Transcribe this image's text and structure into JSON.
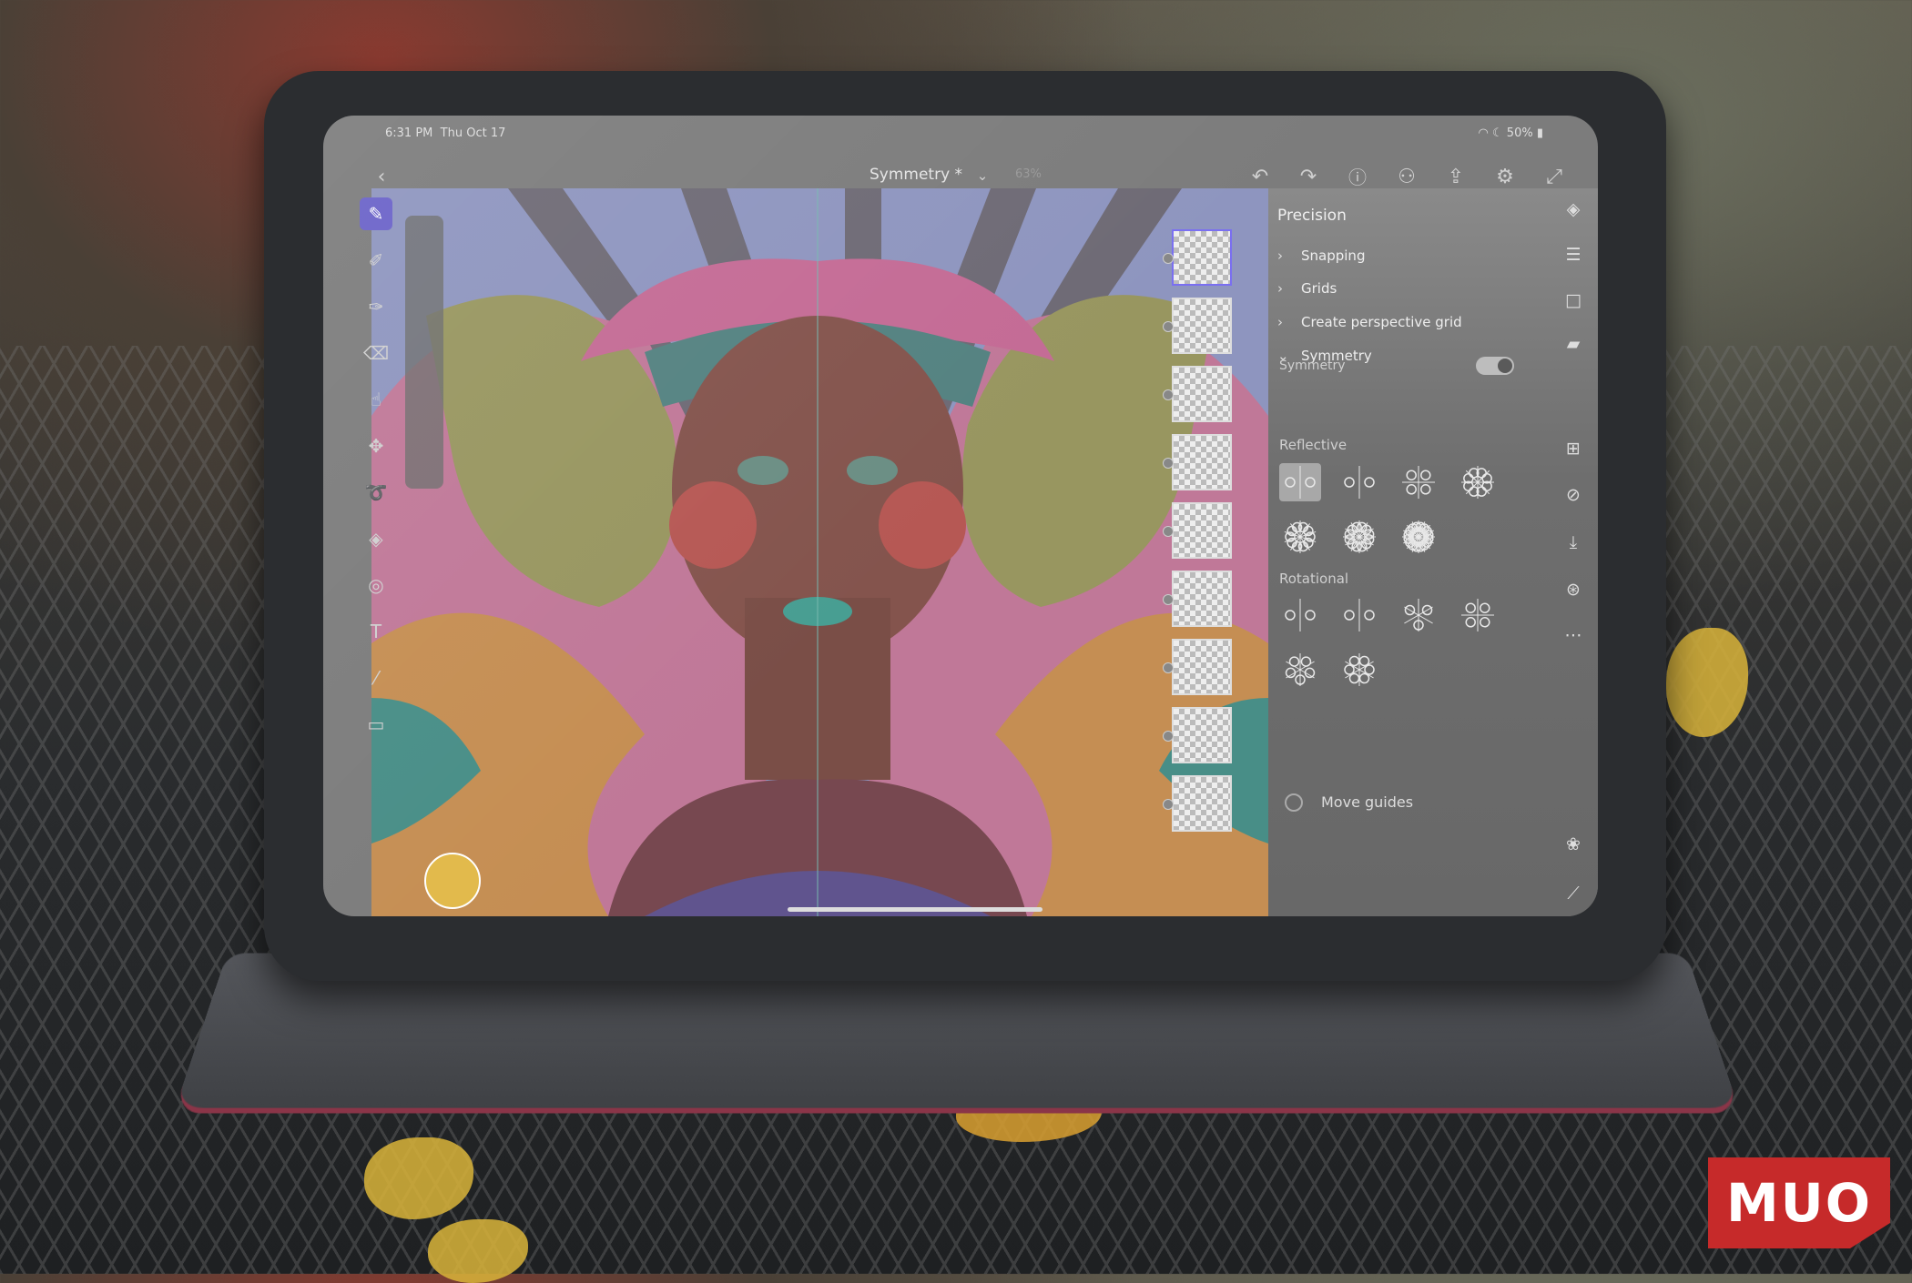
{
  "status_bar": {
    "time": "6:31 PM",
    "date": "Thu Oct 17",
    "battery": "50%"
  },
  "top_bar": {
    "document_title": "Symmetry *",
    "zoom": "63%",
    "icons": [
      "back-icon",
      "undo-icon",
      "redo-icon",
      "help-icon",
      "add-person-icon",
      "share-icon",
      "settings-icon",
      "fullscreen-icon"
    ]
  },
  "tools": [
    "brush-icon",
    "pixel-brush-icon",
    "live-brush-icon",
    "eraser-icon",
    "smudge-icon",
    "move-icon",
    "lasso-icon",
    "fill-icon",
    "shape-icon",
    "text-icon",
    "eyedropper-icon",
    "image-icon"
  ],
  "panel": {
    "title": "Precision",
    "sections": [
      {
        "label": "Snapping",
        "expanded": false
      },
      {
        "label": "Grids",
        "expanded": false
      },
      {
        "label": "Create perspective grid",
        "expanded": false
      },
      {
        "label": "Symmetry",
        "expanded": true
      }
    ],
    "symmetry_toggle_label": "Symmetry",
    "symmetry_on": true,
    "reflective_label": "Reflective",
    "rotational_label": "Rotational",
    "move_guides_label": "Move guides",
    "selected_mode": "reflective-vertical"
  },
  "colors": {
    "accent": "#6a62c8",
    "panel": "#6e6e6e",
    "current_color": "#e2b94a"
  },
  "watermark": "MUO"
}
